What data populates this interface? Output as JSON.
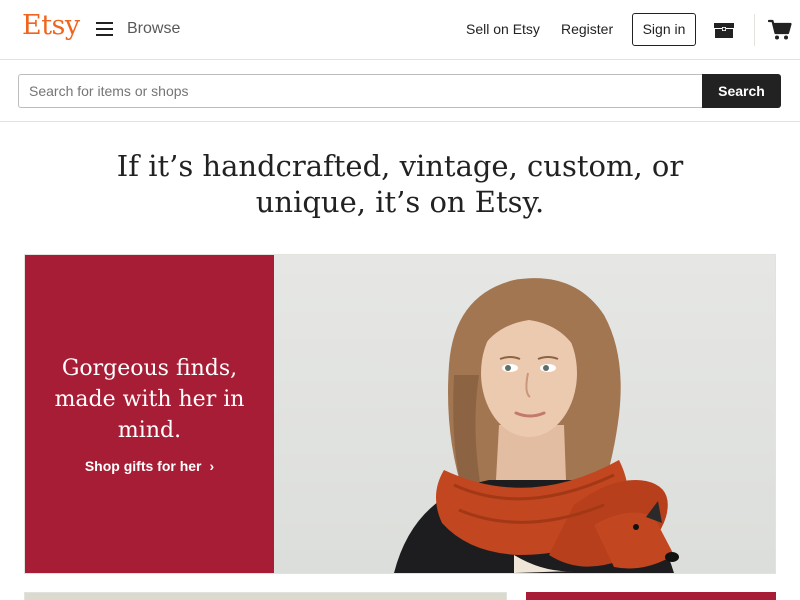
{
  "header": {
    "logo": "Etsy",
    "browse_label": "Browse",
    "sell_label": "Sell on Etsy",
    "register_label": "Register",
    "signin_label": "Sign in",
    "icons": {
      "menu": "hamburger-menu-icon",
      "shop_manager": "shop-manager-icon",
      "cart": "cart-icon"
    }
  },
  "search": {
    "placeholder": "Search for items or shops",
    "value": "",
    "button_label": "Search"
  },
  "hero": {
    "tagline_line1": "If it’s handcrafted, vintage, custom, or",
    "tagline_line2": "unique, it’s on Etsy."
  },
  "banner": {
    "headline": "Gorgeous finds, made with her in mind.",
    "link_label": "Shop gifts for her",
    "link_icon": "chevron-right-icon"
  },
  "colors": {
    "brand_orange": "#F1641E",
    "banner_red": "#A81D36",
    "button_dark": "#222222",
    "scarf_orange": "#C2461F"
  }
}
